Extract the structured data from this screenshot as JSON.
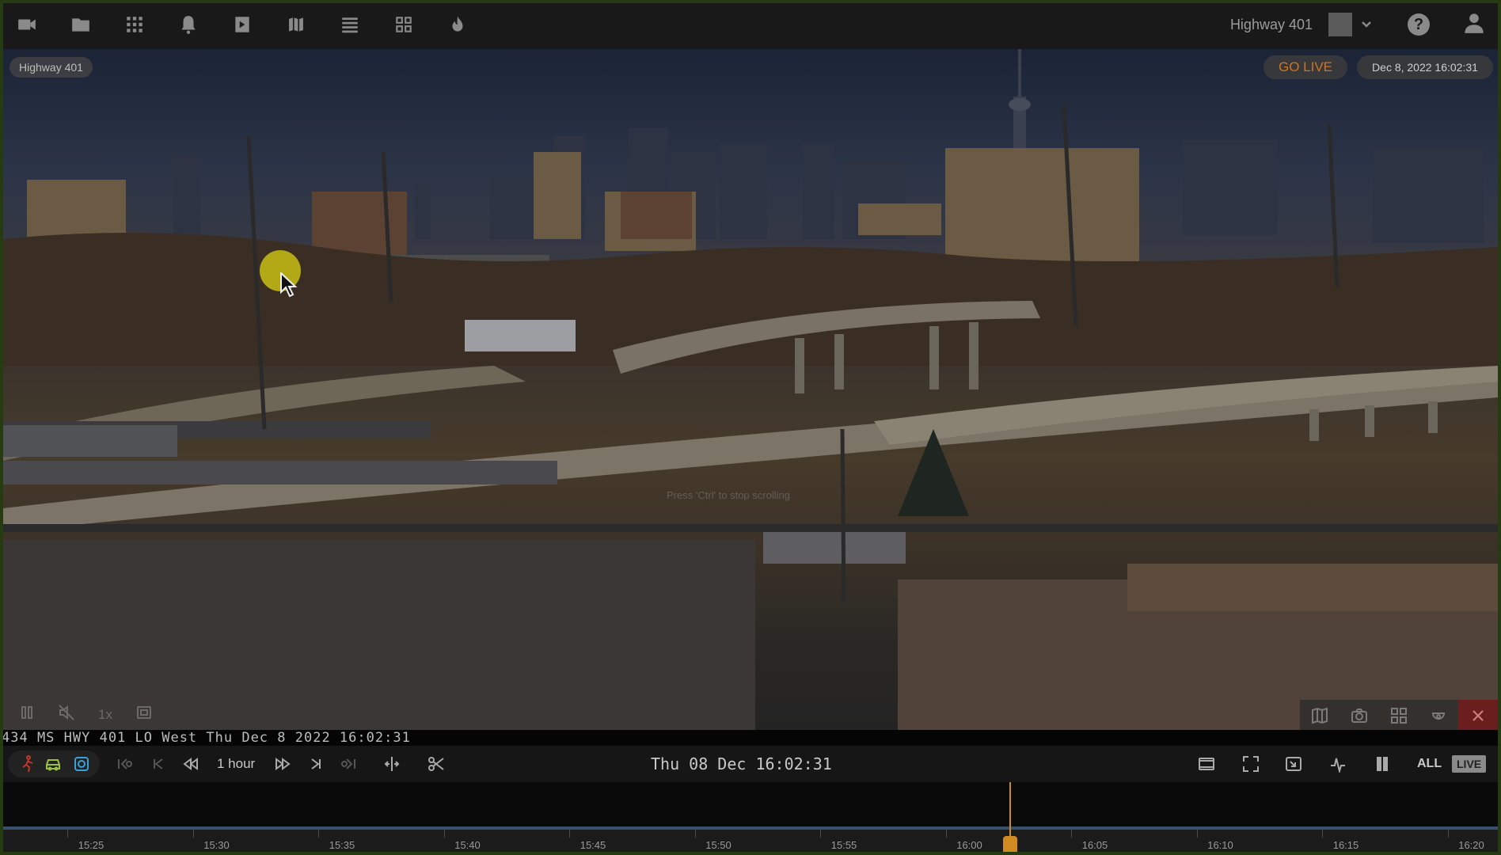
{
  "topbar": {
    "icons": [
      "video-camera-icon",
      "folder-icon",
      "apps-grid-icon",
      "bell-icon",
      "playback-icon",
      "map-icon",
      "list-icon",
      "layout-grid-icon",
      "fire-icon"
    ],
    "camera_name": "Highway 401"
  },
  "video": {
    "camera_label": "Highway 401",
    "go_live_label": "GO LIVE",
    "timestamp_badge": "Dec 8, 2022 16:02:31",
    "overlay_hint": "Press 'Ctrl' to stop scrolling",
    "speed_label": "1x"
  },
  "osd_text": "434 MS HWY 401 LO West Thu Dec  8 2022 16:02:31",
  "controls": {
    "range_label": "1 hour",
    "center_time": "Thu 08 Dec  16:02:31",
    "all_label": "ALL",
    "live_label": "LIVE"
  },
  "timeline": {
    "ticks": [
      "15:25",
      "15:30",
      "15:35",
      "15:40",
      "15:45",
      "15:50",
      "15:55",
      "16:00",
      "16:05",
      "16:10",
      "16:15",
      "16:20"
    ]
  },
  "colors": {
    "accent_orange": "#d08a22",
    "go_live": "#d0741e",
    "border_green": "#263b12"
  }
}
